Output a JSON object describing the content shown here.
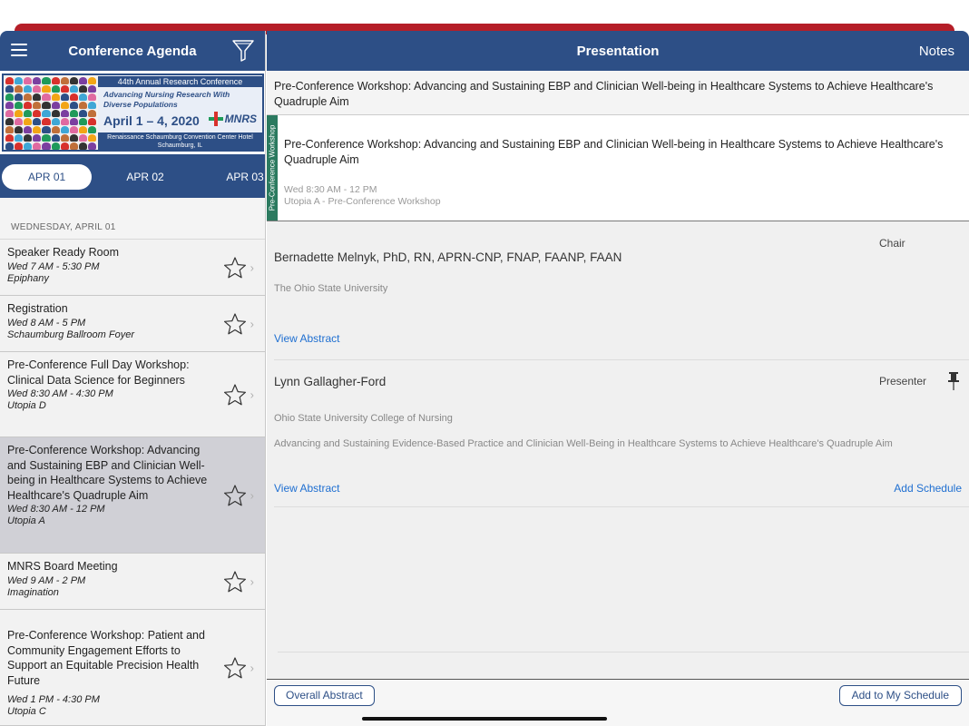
{
  "colors": {
    "header_bg": "#2d4f86",
    "accent_red": "#b51e28",
    "track_green": "#2b7a5f",
    "link_blue": "#1f6fd1",
    "selected_row": "#d0d0d6"
  },
  "left": {
    "title": "Conference Agenda",
    "menu_icon": "hamburger-icon",
    "filter_icon": "funnel-icon",
    "banner": {
      "line1": "44th Annual Research Conference",
      "line2": "Advancing Nursing Research With Diverse Populations",
      "dates": "April 1 – 4, 2020",
      "logo": "MNRS",
      "venue": "Renaissance Schaumburg Convention Center Hotel",
      "city": "Schaumburg, IL"
    },
    "date_tabs": [
      "APR 01",
      "APR 02",
      "APR 03"
    ],
    "day_header": "WEDNESDAY, APRIL 01",
    "sessions": [
      {
        "title": "Speaker Ready Room",
        "time": "Wed 7 AM - 5:30 PM",
        "room": "Epiphany"
      },
      {
        "title": "Registration",
        "time": "Wed 8 AM - 5 PM",
        "room": "Schaumburg Ballroom Foyer"
      },
      {
        "title": "Pre-Conference Full Day Workshop: Clinical Data Science for Beginners",
        "time": "Wed 8:30 AM - 4:30 PM",
        "room": "Utopia D"
      },
      {
        "title": "Pre-Conference Workshop: Advancing and Sustaining EBP and Clinician Well-being in Healthcare Systems to Achieve Healthcare's Quadruple Aim",
        "time": "Wed 8:30 AM - 12 PM",
        "room": "Utopia A"
      },
      {
        "title": "MNRS Board Meeting",
        "time": "Wed 9 AM - 2 PM",
        "room": "Imagination"
      },
      {
        "title": "Pre-Conference Workshop: Patient and Community Engagement Efforts to Support an Equitable Precision Health Future",
        "time": "Wed 1 PM - 4:30 PM",
        "room": "Utopia C"
      }
    ]
  },
  "right": {
    "title": "Presentation",
    "notes_label": "Notes",
    "header_text": "Pre-Conference Workshop: Advancing and Sustaining EBP and Clinician Well-being in Healthcare Systems to Achieve Healthcare's Quadruple Aim",
    "track_label": "Pre-Conference Workshop",
    "card_title": "Pre-Conference Workshop: Advancing and Sustaining EBP and Clinician Well-being in Healthcare Systems to Achieve Healthcare's Quadruple Aim",
    "card_time": "Wed 8:30 AM - 12 PM",
    "card_location": "Utopia A - Pre-Conference Workshop",
    "people": [
      {
        "name": "Bernadette Melnyk, PhD, RN, APRN-CNP, FNAP, FAANP, FAAN",
        "role": "Chair",
        "affiliation": "The Ohio State University",
        "view_abstract": "View Abstract"
      },
      {
        "name": "Lynn Gallagher-Ford",
        "role": "Presenter",
        "affiliation": "Ohio State University College of Nursing",
        "abstract_title": "Advancing and Sustaining Evidence-Based Practice and Clinician Well-Being in Healthcare Systems to Achieve Healthcare's Quadruple Aim",
        "view_abstract": "View Abstract",
        "add_schedule": "Add Schedule"
      }
    ],
    "overall_abstract": "Overall Abstract",
    "add_to_schedule": "Add to My Schedule"
  }
}
